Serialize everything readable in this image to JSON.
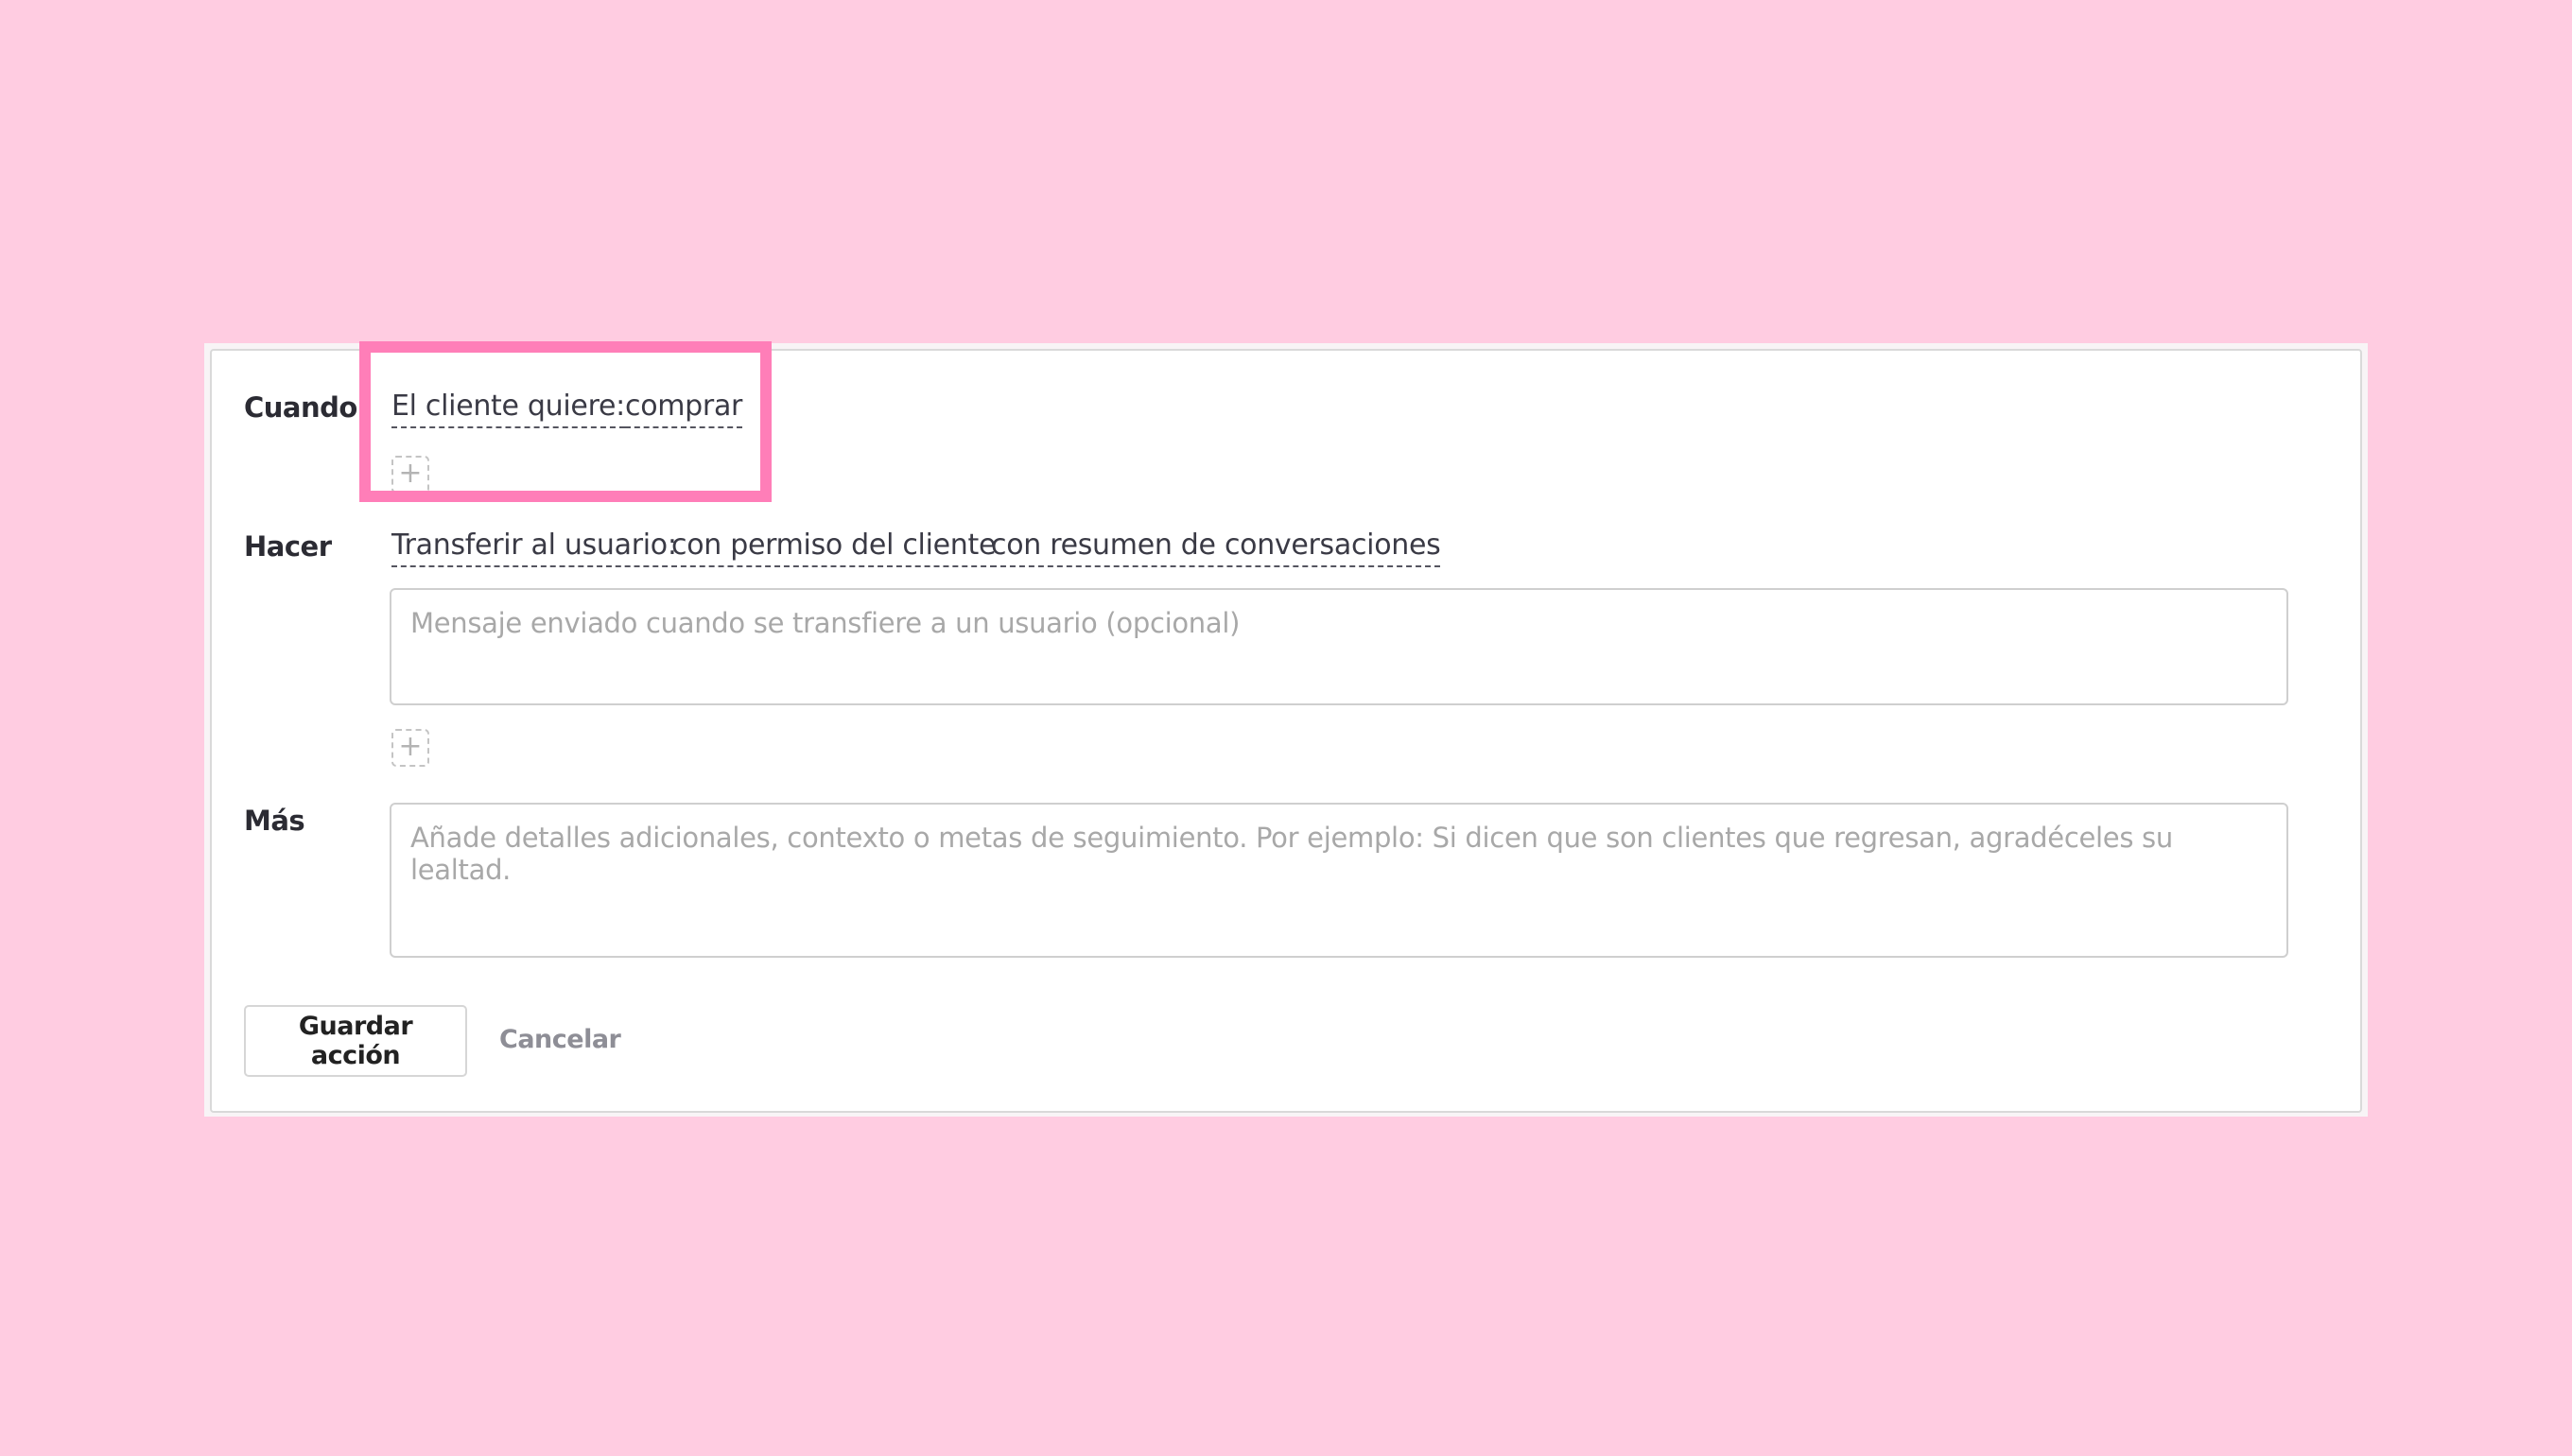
{
  "when": {
    "label": "Cuando",
    "condition_label": "El cliente quiere:",
    "condition_value": "comprar",
    "add_symbol": "+"
  },
  "do": {
    "label": "Hacer",
    "action_label": "Transferir al usuario:",
    "option_1": "con permiso del cliente",
    "option_2": "con resumen de conversaciones",
    "message_placeholder": "Mensaje enviado cuando se transfiere a un usuario (opcional)",
    "message_value": "",
    "add_symbol": "+"
  },
  "more": {
    "label": "Más",
    "details_placeholder": "Añade detalles adicionales, contexto o metas de seguimiento. Por ejemplo: Si dicen que son clientes que regresan, agradéceles su lealtad.",
    "details_value": ""
  },
  "footer": {
    "save_label": "Guardar acción",
    "cancel_label": "Cancelar"
  },
  "colors": {
    "background": "#ffcce1",
    "highlight": "#ff7eb8"
  },
  "icons": {
    "add": "plus-icon"
  }
}
